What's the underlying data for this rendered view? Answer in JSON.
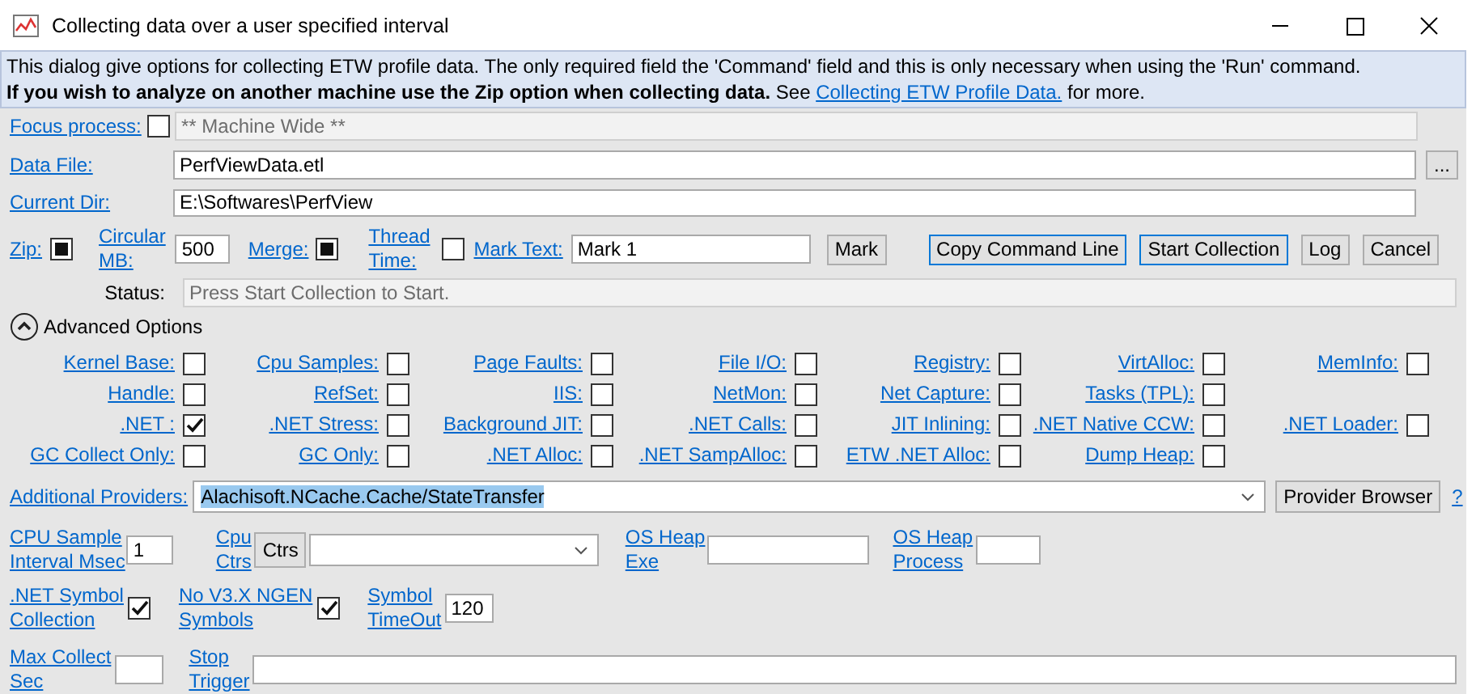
{
  "window": {
    "title": "Collecting data over a user specified interval"
  },
  "intro": {
    "line_1": "This dialog give options for collecting ETW profile data. The only required field the 'Command' field and this is only necessary when using the 'Run' command.",
    "line_2": "**If you wish to analyze on another machine use the Zip option when collecting data.** See ",
    "link": "Collecting ETW Profile Data.",
    "line_2_end": " for more."
  },
  "focus_process": {
    "label": "Focus process:",
    "checked": false,
    "value": "** Machine Wide **",
    "disabled": true
  },
  "data_file": {
    "label": "Data File:",
    "value": "PerfViewData.etl",
    "browse_button": "..."
  },
  "current_dir": {
    "label": "Current Dir:",
    "value": "E:\\Softwares\\PerfView"
  },
  "options": {
    "zip": {
      "label": "Zip:",
      "indeterminate": true
    },
    "circular_mb": {
      "label": "Circular\nMB:",
      "value": "500"
    },
    "merge": {
      "label": "Merge:",
      "indeterminate": true
    },
    "thread_time": {
      "label": "Thread\nTime:",
      "indeterminate": false
    },
    "mark_text": {
      "label": "Mark Text:",
      "value": "Mark 1"
    },
    "buttons": [
      {
        "label": "Mark",
        "focused": false
      },
      {
        "label": "Copy Command Line",
        "focused": true
      },
      {
        "label": "Start Collection",
        "focused": true
      },
      {
        "label": "Log",
        "focused": false
      },
      {
        "label": "Cancel",
        "focused": false
      }
    ]
  },
  "status": {
    "label": "Status:",
    "value": "Press Start Collection to Start.",
    "disabled": true
  },
  "advanced": {
    "label": "Advanced Options",
    "expanded": true,
    "rows": [
      [
        {
          "label": "Kernel Base:",
          "checked": false
        },
        {
          "label": "Cpu Samples:",
          "checked": false
        },
        {
          "label": "Page Faults:",
          "checked": false
        },
        {
          "label": "File I/O:",
          "checked": false
        },
        {
          "label": "Registry:",
          "checked": false
        },
        {
          "label": "VirtAlloc:",
          "checked": false
        },
        {
          "label": "MemInfo:",
          "checked": false
        }
      ],
      [
        {
          "label": "Handle:",
          "checked": false
        },
        {
          "label": "RefSet:",
          "checked": false
        },
        {
          "label": "IIS:",
          "checked": false
        },
        {
          "label": "NetMon:",
          "checked": false
        },
        {
          "label": "Net Capture:",
          "checked": false
        },
        {
          "label": "Tasks (TPL):",
          "checked": false
        }
      ],
      [
        {
          "label": ".NET :",
          "checked": true
        },
        {
          "label": ".NET Stress:",
          "checked": false
        },
        {
          "label": "Background JIT:",
          "checked": false
        },
        {
          "label": ".NET Calls:",
          "checked": false
        },
        {
          "label": "JIT Inlining:",
          "checked": false
        },
        {
          "label": ".NET Native CCW:",
          "checked": false
        },
        {
          "label": ".NET Loader:",
          "checked": false
        }
      ],
      [
        {
          "label": "GC Collect Only:",
          "checked": false
        },
        {
          "label": "GC Only:",
          "checked": false
        },
        {
          "label": ".NET Alloc:",
          "checked": false
        },
        {
          "label": ".NET SampAlloc:",
          "checked": false
        },
        {
          "label": "ETW .NET Alloc:",
          "checked": false
        },
        {
          "label": "Dump Heap:",
          "checked": false
        }
      ]
    ]
  },
  "additional_providers": {
    "label": "Additional Providers:",
    "value": "Alachisoft.NCache.Cache/StateTransfer",
    "selected": true,
    "button": "Provider Browser",
    "help": "?"
  },
  "cpu_sample": {
    "label": "CPU Sample\nInterval Msec",
    "value": "1"
  },
  "cpu_ctrs": {
    "label": "Cpu\nCtrs",
    "button": "Ctrs"
  },
  "os_heap_exe": {
    "label": "OS Heap\nExe"
  },
  "os_heap_process": {
    "label": "OS Heap\nProcess"
  },
  "net_symbol": {
    "label": ".NET Symbol\nCollection",
    "checked": true
  },
  "no_ngen": {
    "label": "No V3.X NGEN\nSymbols",
    "checked": true
  },
  "symbol_timeout": {
    "label": "Symbol\nTimeOut",
    "value": "120"
  },
  "max_collect": {
    "label": "Max Collect\nSec"
  },
  "stop_trigger": {
    "label": "Stop\nTrigger"
  }
}
